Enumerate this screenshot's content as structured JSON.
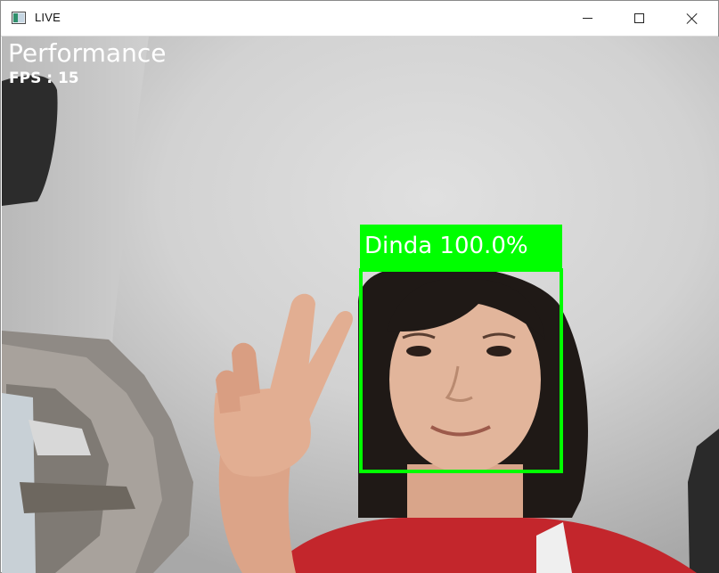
{
  "window": {
    "title": "LIVE",
    "icon": "app-window-icon",
    "controls": [
      "minimize-icon",
      "maximize-icon",
      "close-icon"
    ]
  },
  "overlay": {
    "heading": "Performance",
    "fps_text": "FPS : 15"
  },
  "detection": {
    "label": "Dinda 100.0%",
    "name": "Dinda",
    "confidence_percent": 100.0,
    "box_color": "#00ff00"
  }
}
